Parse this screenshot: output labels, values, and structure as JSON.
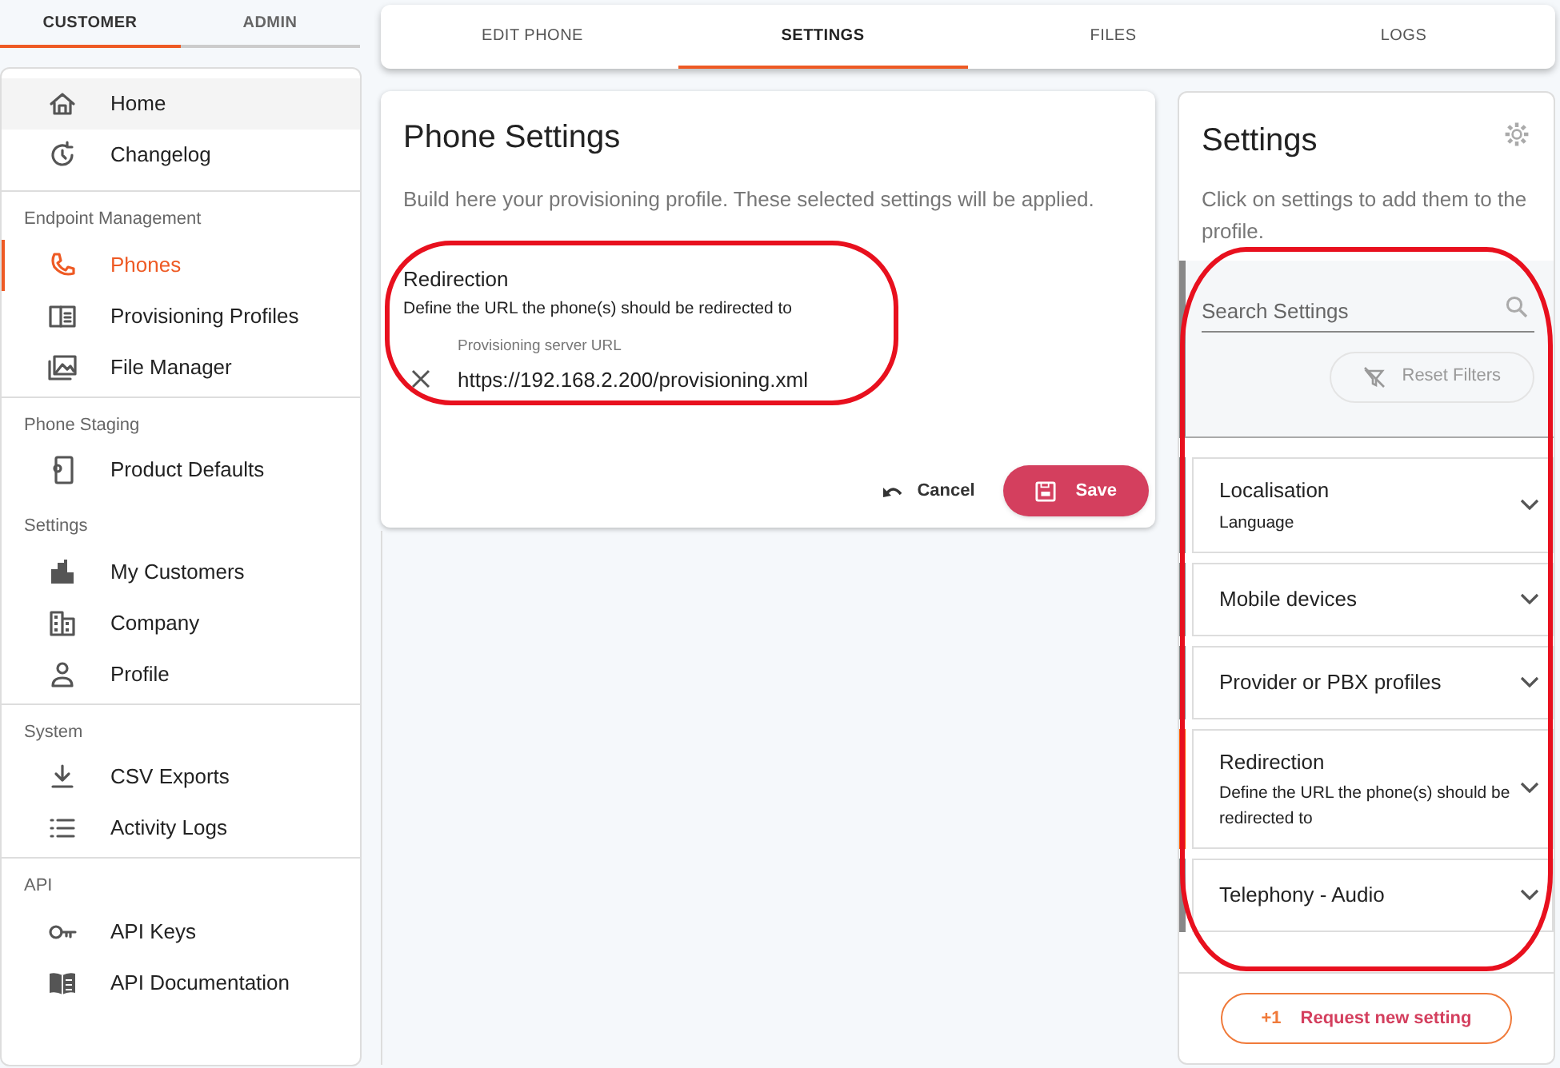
{
  "role_tabs": [
    {
      "label": "CUSTOMER",
      "selected": true
    },
    {
      "label": "ADMIN",
      "selected": false
    }
  ],
  "nav": [
    {
      "items": [
        {
          "label": "Home",
          "selected": false
        },
        {
          "label": "Changelog",
          "selected": false
        }
      ]
    },
    {
      "heading": "Endpoint Management",
      "items": [
        {
          "label": "Phones",
          "selected": true
        },
        {
          "label": "Provisioning Profiles",
          "selected": false
        },
        {
          "label": "File Manager",
          "selected": false
        }
      ]
    },
    {
      "heading": "Phone Staging",
      "items": [
        {
          "label": "Product Defaults",
          "selected": false
        }
      ]
    },
    {
      "heading": "Settings",
      "items": [
        {
          "label": "My Customers",
          "selected": false
        },
        {
          "label": "Company",
          "selected": false
        },
        {
          "label": "Profile",
          "selected": false
        }
      ]
    },
    {
      "heading": "System",
      "items": [
        {
          "label": "CSV Exports",
          "selected": false
        },
        {
          "label": "Activity Logs",
          "selected": false
        }
      ]
    },
    {
      "heading": "API",
      "items": [
        {
          "label": "API Keys",
          "selected": false
        },
        {
          "label": "API Documentation",
          "selected": false
        }
      ]
    }
  ],
  "tabs": [
    {
      "label": "EDIT PHONE",
      "selected": false
    },
    {
      "label": "SETTINGS",
      "selected": true
    },
    {
      "label": "FILES",
      "selected": false
    },
    {
      "label": "LOGS",
      "selected": false
    }
  ],
  "phone_settings": {
    "title": "Phone Settings",
    "description": "Build here your provisioning profile. These selected settings will be applied.",
    "setting": {
      "title": "Redirection",
      "description": "Define the URL the phone(s) should be redirected to",
      "field_label": "Provisioning server URL",
      "value": "https://192.168.2.200/provisioning.xml"
    },
    "buttons": [
      {
        "label": "Cancel",
        "kind": "text"
      },
      {
        "label": "Save",
        "kind": "primary"
      }
    ]
  },
  "settings_panel": {
    "title": "Settings",
    "description": "Click on settings to add them to the profile.",
    "search": {
      "placeholder": "Search Settings"
    },
    "reset_button": {
      "label": "Reset Filters",
      "disabled": true
    },
    "items": [
      {
        "title": "Localisation",
        "subtitle": "Language",
        "selected": false
      },
      {
        "title": "Mobile devices",
        "selected": false
      },
      {
        "title": "Provider or PBX profiles",
        "selected": false
      },
      {
        "title": "Redirection",
        "subtitle": "Define the URL the phone(s) should be redirected to",
        "selected": true
      },
      {
        "title": "Telephony - Audio",
        "selected": false
      }
    ],
    "request_button": {
      "badge": "+1",
      "label": "Request new setting"
    }
  },
  "annotations": [
    {
      "kind": "ellipse"
    },
    {
      "kind": "rounded-box"
    }
  ]
}
